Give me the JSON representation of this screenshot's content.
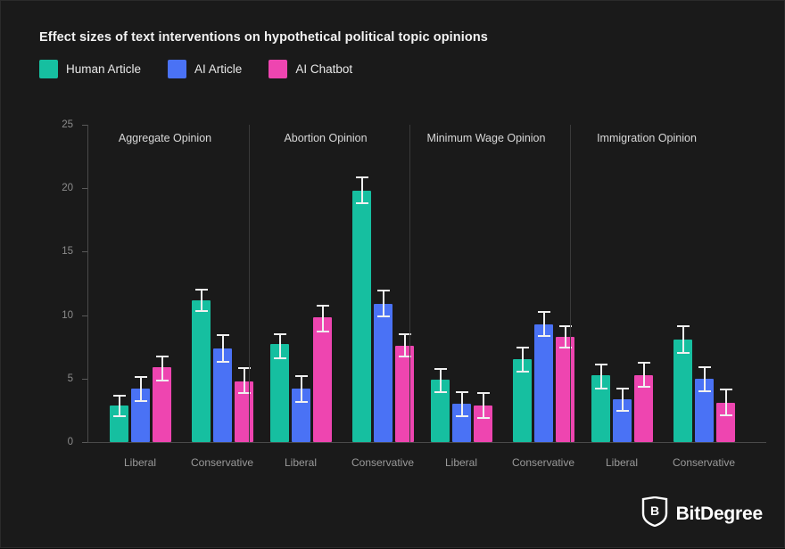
{
  "title": "Effect sizes of text interventions on hypothetical political topic opinions",
  "colors": {
    "background": "#1a1a1a",
    "human_article": "#16bfa0",
    "ai_article": "#4a72f5",
    "ai_chatbot": "#ee45b0",
    "error_bar": "#f0f0f0",
    "axis": "#4a4a4a",
    "tick_text": "#8c8c8c",
    "panel_title": "#d8d8d8",
    "group_label": "#9a9a9a"
  },
  "legend": [
    {
      "label": "Human Article",
      "color": "#16bfa0",
      "key": "human_article"
    },
    {
      "label": "AI Article",
      "color": "#4a72f5",
      "key": "ai_article"
    },
    {
      "label": "AI Chatbot",
      "color": "#ee45b0",
      "key": "ai_chatbot"
    }
  ],
  "watermark": {
    "text": "BitDegree",
    "icon": "bitdegree-shield-logo"
  },
  "chart_data": {
    "type": "bar",
    "title": "Effect sizes of text interventions on hypothetical political topic opinions",
    "xlabel": "",
    "ylabel": "",
    "ylim": [
      0,
      25
    ],
    "yticks": [
      0,
      5,
      10,
      15,
      20,
      25
    ],
    "grid": false,
    "legend_position": "top-left",
    "error_bars": "95% confidence interval",
    "facet_variable": "Political topic",
    "group_variable": "Political leaning",
    "categories": [
      "Liberal",
      "Conservative"
    ],
    "series_names": [
      "Human Article",
      "AI Article",
      "AI Chatbot"
    ],
    "panels": [
      {
        "name": "Aggregate Opinion",
        "groups": [
          {
            "category": "Liberal",
            "bars": [
              {
                "series": "Human Article",
                "value": 2.9,
                "err_low": 2.1,
                "err_high": 3.7
              },
              {
                "series": "AI Article",
                "value": 4.2,
                "err_low": 3.3,
                "err_high": 5.2
              },
              {
                "series": "AI Chatbot",
                "value": 5.9,
                "err_low": 4.9,
                "err_high": 6.8
              }
            ]
          },
          {
            "category": "Conservative",
            "bars": [
              {
                "series": "Human Article",
                "value": 11.2,
                "err_low": 10.4,
                "err_high": 12.1
              },
              {
                "series": "AI Article",
                "value": 7.4,
                "err_low": 6.4,
                "err_high": 8.5
              },
              {
                "series": "AI Chatbot",
                "value": 4.8,
                "err_low": 3.9,
                "err_high": 5.9
              }
            ]
          }
        ]
      },
      {
        "name": "Abortion Opinion",
        "groups": [
          {
            "category": "Liberal",
            "bars": [
              {
                "series": "Human Article",
                "value": 7.7,
                "err_low": 6.7,
                "err_high": 8.6
              },
              {
                "series": "AI Article",
                "value": 4.2,
                "err_low": 3.2,
                "err_high": 5.3
              },
              {
                "series": "AI Chatbot",
                "value": 9.8,
                "err_low": 8.8,
                "err_high": 10.8
              }
            ]
          },
          {
            "category": "Conservative",
            "bars": [
              {
                "series": "Human Article",
                "value": 19.8,
                "err_low": 18.9,
                "err_high": 20.9
              },
              {
                "series": "AI Article",
                "value": 10.9,
                "err_low": 10.0,
                "err_high": 12.0
              },
              {
                "series": "AI Chatbot",
                "value": 7.6,
                "err_low": 6.8,
                "err_high": 8.6
              }
            ]
          }
        ]
      },
      {
        "name": "Minimum Wage Opinion",
        "groups": [
          {
            "category": "Liberal",
            "bars": [
              {
                "series": "Human Article",
                "value": 4.9,
                "err_low": 4.0,
                "err_high": 5.8
              },
              {
                "series": "AI Article",
                "value": 3.0,
                "err_low": 2.1,
                "err_high": 4.0
              },
              {
                "series": "AI Chatbot",
                "value": 2.9,
                "err_low": 2.0,
                "err_high": 3.9
              }
            ]
          },
          {
            "category": "Conservative",
            "bars": [
              {
                "series": "Human Article",
                "value": 6.5,
                "err_low": 5.6,
                "err_high": 7.5
              },
              {
                "series": "AI Article",
                "value": 9.3,
                "err_low": 8.4,
                "err_high": 10.3
              },
              {
                "series": "AI Chatbot",
                "value": 8.3,
                "err_low": 7.5,
                "err_high": 9.2
              }
            ]
          }
        ]
      },
      {
        "name": "Immigration Opinion",
        "groups": [
          {
            "category": "Liberal",
            "bars": [
              {
                "series": "Human Article",
                "value": 5.3,
                "err_low": 4.3,
                "err_high": 6.2
              },
              {
                "series": "AI Article",
                "value": 3.4,
                "err_low": 2.5,
                "err_high": 4.3
              },
              {
                "series": "AI Chatbot",
                "value": 5.3,
                "err_low": 4.4,
                "err_high": 6.3
              }
            ]
          },
          {
            "category": "Conservative",
            "bars": [
              {
                "series": "Human Article",
                "value": 8.1,
                "err_low": 7.1,
                "err_high": 9.2
              },
              {
                "series": "AI Article",
                "value": 5.0,
                "err_low": 4.1,
                "err_high": 6.0
              },
              {
                "series": "AI Chatbot",
                "value": 3.1,
                "err_low": 2.2,
                "err_high": 4.2
              }
            ]
          }
        ]
      }
    ]
  }
}
